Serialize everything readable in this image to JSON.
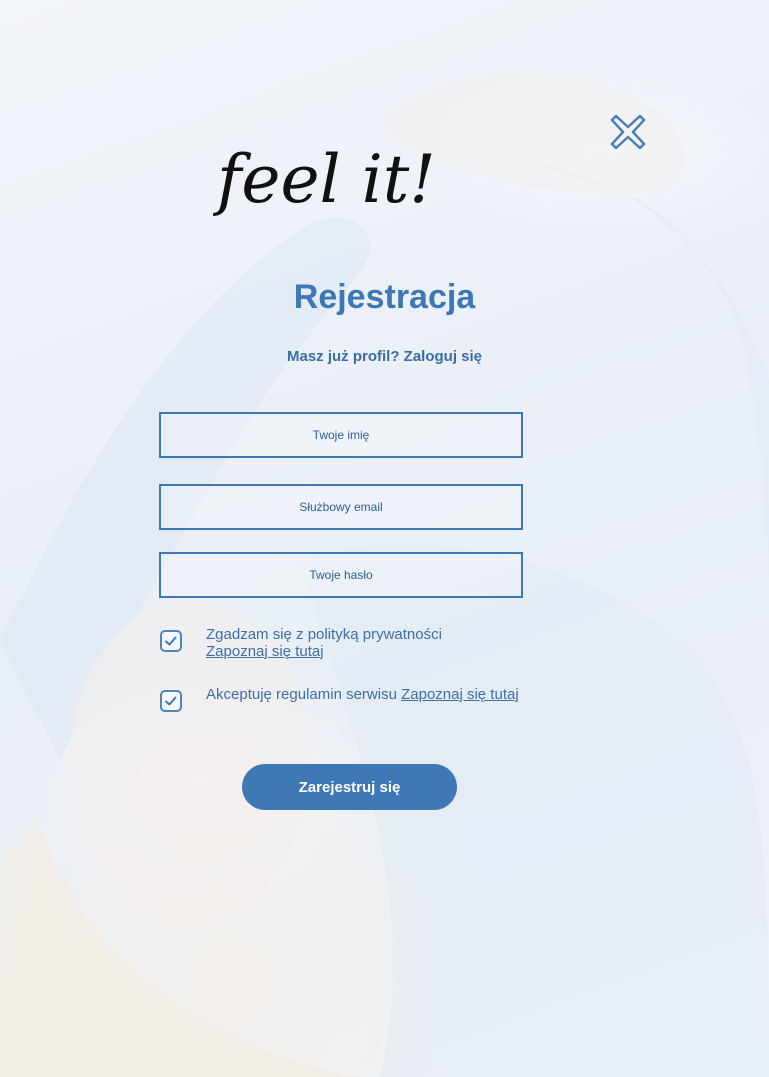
{
  "logo": {
    "text": "feel it!"
  },
  "header": {
    "title": "Rejestracja",
    "login_prompt": "Masz już profil?",
    "login_link": "Zaloguj się"
  },
  "form": {
    "name_placeholder": "Twoje imię",
    "email_placeholder": "Służbowy email",
    "password_placeholder": "Twoje hasło",
    "privacy": {
      "checked": true,
      "text": "Zgadzam się z polityką prywatności",
      "link": "Zapoznaj się tutaj"
    },
    "terms": {
      "checked": true,
      "text": "Akceptuję regulamin serwisu",
      "link": "Zapoznaj się tutaj"
    },
    "submit_label": "Zarejestruj się"
  },
  "icons": {
    "close": "close-icon",
    "check": "checkmark-icon"
  },
  "colors": {
    "accent": "#3f79b5",
    "text": "#3d6fa8",
    "background": "#e9f0f7"
  }
}
